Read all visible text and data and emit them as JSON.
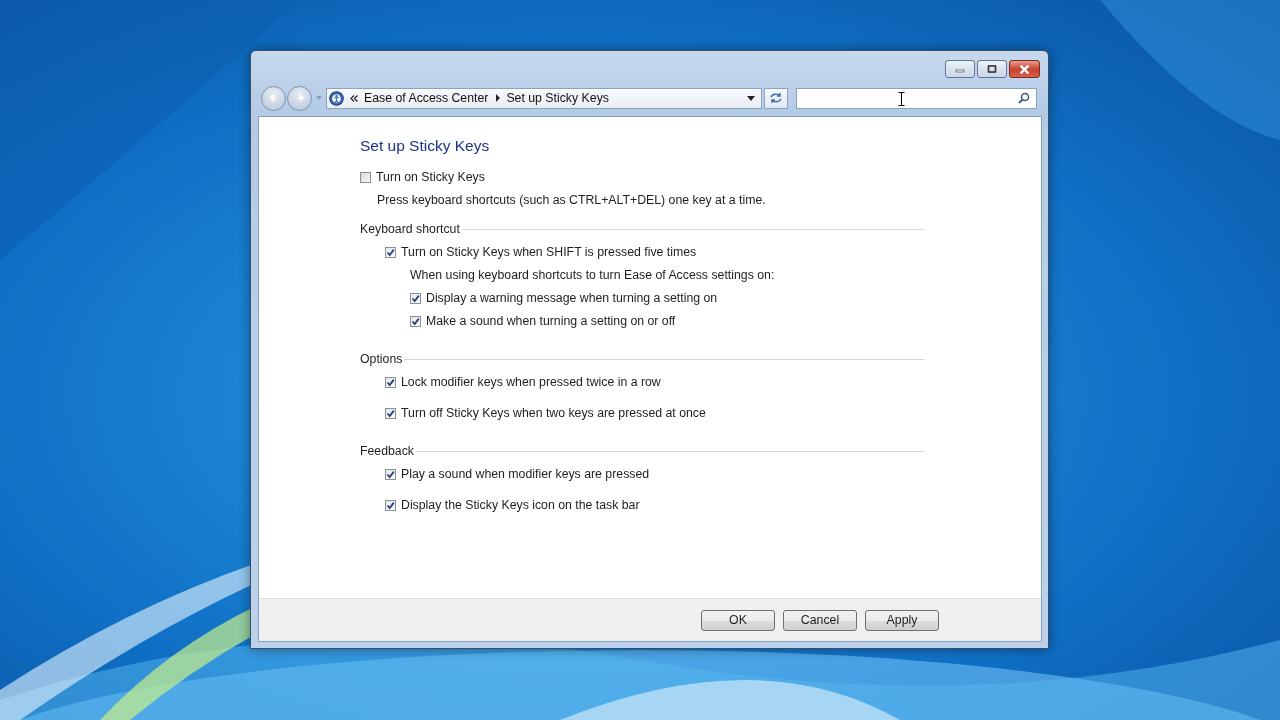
{
  "address_bar": {
    "crumbs": [
      "Ease of Access Center",
      "Set up Sticky Keys"
    ]
  },
  "heading": "Set up Sticky Keys",
  "main_option": {
    "label": "Turn on Sticky Keys",
    "checked": false,
    "description": "Press keyboard shortcuts (such as CTRL+ALT+DEL) one key at a time."
  },
  "sections": [
    {
      "title": "Keyboard shortcut",
      "items": [
        {
          "kind": "checkbox",
          "label": "Turn on Sticky Keys when SHIFT is pressed five times",
          "checked": true,
          "children": [
            {
              "kind": "text",
              "label": "When using keyboard shortcuts to turn Ease of Access settings on:"
            },
            {
              "kind": "checkbox",
              "label": "Display a warning message when turning a setting on",
              "checked": true
            },
            {
              "kind": "checkbox",
              "label": "Make a sound when turning a setting on or off",
              "checked": true
            }
          ]
        }
      ]
    },
    {
      "title": "Options",
      "items": [
        {
          "kind": "checkbox",
          "label": "Lock modifier keys when pressed twice in a row",
          "checked": true
        },
        {
          "kind": "checkbox",
          "label": "Turn off Sticky Keys when two keys are pressed at once",
          "checked": true
        }
      ]
    },
    {
      "title": "Feedback",
      "items": [
        {
          "kind": "checkbox",
          "label": "Play a sound when modifier keys are pressed",
          "checked": true
        },
        {
          "kind": "checkbox",
          "label": "Display the Sticky Keys icon on the task bar",
          "checked": true
        }
      ]
    }
  ],
  "buttons": [
    "OK",
    "Cancel",
    "Apply"
  ]
}
